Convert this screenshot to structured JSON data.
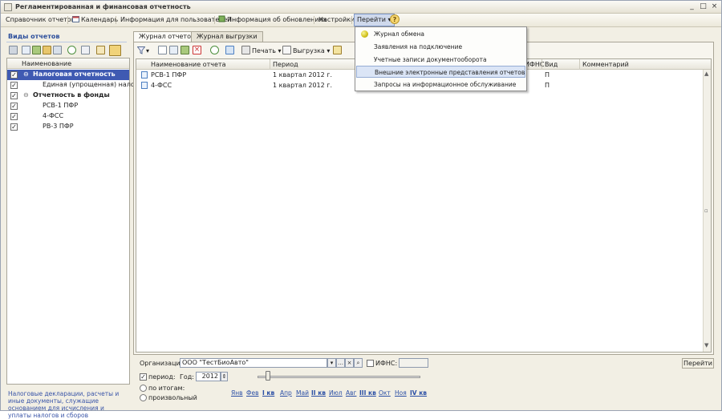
{
  "window": {
    "title": "Регламентированная и финансовая отчетность",
    "buttons": {
      "minimize": "_",
      "maximize": "□",
      "close": "×"
    }
  },
  "menu": {
    "items": [
      {
        "label": "Справочник отчетов"
      },
      {
        "label": "Календарь"
      },
      {
        "label": "Информация для пользователей"
      },
      {
        "label": "Информация об обновлениях"
      },
      {
        "label": "Настройки"
      },
      {
        "label": "Перейти"
      }
    ],
    "help": "?"
  },
  "dropdown": {
    "items": [
      {
        "label": "Журнал обмена"
      },
      {
        "label": "Заявления на подключение"
      },
      {
        "label": "Учетные записи документооборота"
      },
      {
        "label": "Внешние электронные представления отчетов"
      },
      {
        "label": "Запросы на информационное обслуживание"
      }
    ]
  },
  "left": {
    "title": "Виды отчетов",
    "header": "Наименование",
    "rows": [
      {
        "label": "Налоговая отчетность",
        "checked": true
      },
      {
        "label": "Единая (упрощенная) нало...",
        "checked": true
      },
      {
        "label": "Отчетность в фонды",
        "checked": true
      },
      {
        "label": "РСВ-1 ПФР",
        "checked": true
      },
      {
        "label": "4-ФСС",
        "checked": true
      },
      {
        "label": "РВ-3 ПФР",
        "checked": true
      }
    ],
    "description": "Налоговые декларации, расчеты и иные документы, служащие основанием для исчисления и уплаты налогов и сборов"
  },
  "tabs": [
    {
      "label": "Журнал отчетов"
    },
    {
      "label": "Журнал выгрузки"
    }
  ],
  "toolbar": {
    "print": "Печать",
    "export": "Выгрузка"
  },
  "grid": {
    "columns": {
      "name": "Наименование отчета",
      "period": "Период",
      "ifns": "ИФНС",
      "kind": "Вид",
      "comment": "Комментарий"
    },
    "rows": [
      {
        "name": "РСВ-1 ПФР",
        "period": "1 квартал 2012 г.",
        "kind": "П"
      },
      {
        "name": "4-ФСС",
        "period": "1 квартал 2012 г.",
        "kind": "П"
      }
    ]
  },
  "filters": {
    "org_label": "Организации:",
    "org_value": "ООО \"ТестБиоАвто\"",
    "ifns_label": "ИФНС:",
    "period_label": "период:",
    "year_label": "Год:",
    "year_value": "2012",
    "by_totals": "по итогам:",
    "arbitrary": "произвольный",
    "months": [
      "Янв",
      "Фев",
      "I кв",
      "Апр",
      "Май",
      "II кв",
      "Июл",
      "Авг",
      "III кв",
      "Окт",
      "Ноя",
      "IV кв"
    ]
  },
  "goto_button": "Перейти"
}
